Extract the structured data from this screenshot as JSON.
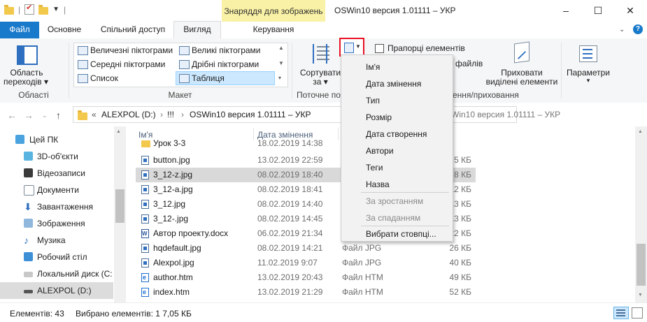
{
  "window": {
    "contextual_tab_title": "Знаряддя для зображень",
    "title": "OSWin10 версия 1.01111 – УКР",
    "minimize": "–",
    "maximize": "☐",
    "close": "✕"
  },
  "tabs": {
    "file": "Файл",
    "home": "Основне",
    "share": "Спільний доступ",
    "view": "Вигляд",
    "manage": "Керування"
  },
  "ribbon": {
    "panes": {
      "nav_pane_line1": "Область",
      "nav_pane_line2": "переходів",
      "group_label": "Області"
    },
    "layout": {
      "items": [
        "Величезні піктограми",
        "Великі піктограми",
        "Середні піктограми",
        "Дрібні піктограми",
        "Список",
        "Таблиця"
      ],
      "group_label": "Макет"
    },
    "current_view": {
      "sort_line1": "Сортувати",
      "sort_line2": "за",
      "group_label_partial": "Поточне по"
    },
    "show_hide": {
      "checkbox_label": "Прапорці елементів",
      "partial_files": "файлів",
      "hide_selected_line1": "Приховати",
      "hide_selected_line2": "виділені елементи",
      "group_label_partial": "ення/приховання"
    },
    "options": {
      "label": "Параметри"
    }
  },
  "address": {
    "prefix": "«",
    "crumbs": [
      "ALEXPOL (D:)",
      "!!!",
      "OSWin10 версия 1.01111 – УКР"
    ],
    "search_partial": "Win10 версия 1.01111 – УКР"
  },
  "nav": {
    "items": [
      "Цей ПК",
      "3D-об'єкти",
      "Відеозаписи",
      "Документи",
      "Завантаження",
      "Зображення",
      "Музика",
      "Робочий стіл",
      "Локальний диск (C:",
      "ALEXPOL (D:)"
    ]
  },
  "list": {
    "columns": {
      "name": "Ім'я",
      "date": "Дата змінення"
    },
    "rows": [
      {
        "name": "Урок 3-3",
        "date": "18.02.2019 14:38",
        "type": "",
        "size": ""
      },
      {
        "name": "button.jpg",
        "date": "13.02.2019 22:59",
        "type": "",
        "size": "5 КБ"
      },
      {
        "name": "3_12-z.jpg",
        "date": "08.02.2019 18:40",
        "type": "",
        "size": "8 КБ"
      },
      {
        "name": "3_12-a.jpg",
        "date": "08.02.2019 18:41",
        "type": "",
        "size": "12 КБ"
      },
      {
        "name": "3_12.jpg",
        "date": "08.02.2019 14:40",
        "type": "",
        "size": "13 КБ"
      },
      {
        "name": "3_12-.jpg",
        "date": "08.02.2019 14:45",
        "type": "",
        "size": "13 КБ"
      },
      {
        "name": "Автор проекту.docx",
        "date": "06.02.2019 21:34",
        "type": "",
        "size": "22 КБ"
      },
      {
        "name": "hqdefault.jpg",
        "date": "08.02.2019 14:21",
        "type": "Файл JPG",
        "size": "26 КБ"
      },
      {
        "name": "Alexpol.jpg",
        "date": "11.02.2019 9:07",
        "type": "Файл JPG",
        "size": "40 КБ"
      },
      {
        "name": "author.htm",
        "date": "13.02.2019 20:43",
        "type": "Файл HTM",
        "size": "49 КБ"
      },
      {
        "name": "index.htm",
        "date": "13.02.2019 21:29",
        "type": "Файл HTM",
        "size": "52 КБ"
      }
    ]
  },
  "sort_menu": {
    "items": [
      "Ім'я",
      "Дата змінення",
      "Тип",
      "Розмір",
      "Дата створення",
      "Автори",
      "Теги",
      "Назва"
    ],
    "ascending": "За зростанням",
    "descending": "За спаданням",
    "choose_columns": "Вибрати стовпці..."
  },
  "status": {
    "items_count": "Елементів: 43",
    "selected": "Вибрано елементів: 1  7,05 КБ"
  },
  "colors": {
    "file_tab": "#1979ca",
    "context_tab": "#f9f1a5",
    "highlight": "#e81123",
    "selection": "#d9d9d9"
  }
}
